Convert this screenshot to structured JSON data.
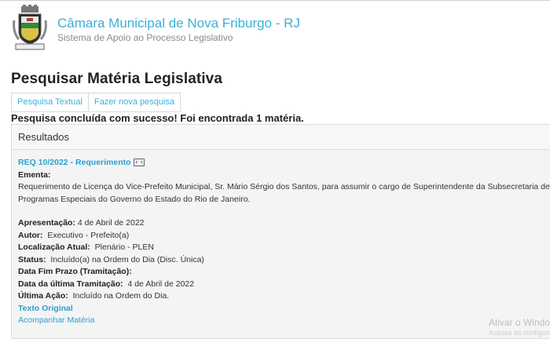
{
  "header": {
    "title": "Câmara Municipal de Nova Friburgo - RJ",
    "subtitle": "Sistema de Apoio ao Processo Legislativo"
  },
  "page": {
    "title": "Pesquisar Matéria Legislativa",
    "tabs": [
      "Pesquisa Textual",
      "Fazer nova pesquisa"
    ],
    "status_message": "Pesquisa concluída com sucesso! Foi encontrada 1 matéria."
  },
  "results": {
    "heading": "Resultados",
    "item": {
      "title": "REQ 10/2022 - Requerimento",
      "ementa_label": "Ementa:",
      "ementa_line1": "Requerimento de Licença do Vice-Prefeito Municipal, Sr. Mário Sérgio dos Santos, para assumir o cargo de Superintendente da Subsecretaria de",
      "ementa_line2": "Programas Especiais do Governo do Estado do Rio de Janeiro.",
      "fields": [
        {
          "label": "Apresentação:",
          "value": " 4 de Abril de 2022"
        },
        {
          "label": "Autor:",
          "value": "  Executivo - Prefeito(a)"
        },
        {
          "label": "Localização Atual:",
          "value": "  Plenário - PLEN"
        },
        {
          "label": "Status:",
          "value": "  Incluído(a) na Ordem do Dia (Disc. Única)"
        },
        {
          "label": "Data Fim Prazo (Tramitação):",
          "value": ""
        },
        {
          "label": "Data da última Tramitação:",
          "value": "  4 de Abril de 2022"
        },
        {
          "label": "Última Ação:",
          "value": "  Incluído na Ordem do Dia."
        }
      ],
      "texto_original": "Texto Original",
      "acompanhar": "Acompanhar Matéria"
    }
  },
  "watermark": {
    "line1": "Ativar o Windows",
    "line2": "Acesse as configurações"
  }
}
